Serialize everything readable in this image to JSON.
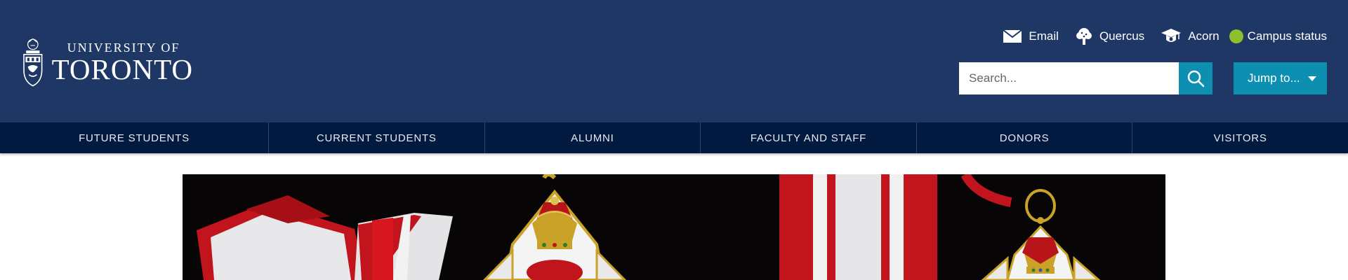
{
  "logo": {
    "line1": "UNIVERSITY OF",
    "line2": "TORONTO"
  },
  "utility": {
    "email": "Email",
    "quercus": "Quercus",
    "acorn": "Acorn",
    "campus_status": "Campus status"
  },
  "search": {
    "placeholder": "Search..."
  },
  "jump": {
    "label": "Jump to..."
  },
  "nav": [
    "FUTURE STUDENTS",
    "CURRENT STUDENTS",
    "ALUMNI",
    "FACULTY AND STAFF",
    "DONORS",
    "VISITORS"
  ],
  "colors": {
    "header_bg": "#1e3765",
    "nav_bg": "#021a3f",
    "accent": "#0c8fb1",
    "status_green": "#8dbf2e"
  },
  "hero": {
    "description": ""
  }
}
